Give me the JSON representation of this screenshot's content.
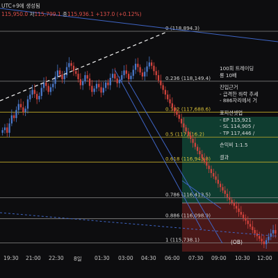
{
  "header": {
    "title_fragment": "UTC+9에 생성됨",
    "ohlc": {
      "open_value": "115,950.0",
      "high_prefix": "저",
      "high_value": "115,799.1",
      "close_prefix": "종",
      "close_value": "115,936.1",
      "change": "+137.0 (+0.12%)"
    }
  },
  "fib_levels": [
    {
      "ratio": "0",
      "price": "118,894.3",
      "text": "0 (118,894.3)",
      "color": "#8a8a8a"
    },
    {
      "ratio": "0.236",
      "price": "118,149.4",
      "text": "0.236 (118,149.4)",
      "color": "#8a8a8a"
    },
    {
      "ratio": "0.382",
      "price": "117,688.6",
      "text": "0.382 (117,688.6)",
      "color": "#c8b02a"
    },
    {
      "ratio": "0.5",
      "price": "117,316.2",
      "text": "0.5 (117,316.2)",
      "color": "#c8b02a"
    },
    {
      "ratio": "0.618",
      "price": "116,943.8",
      "text": "0.618 (116,943.8)",
      "color": "#c8b02a"
    },
    {
      "ratio": "0.786",
      "price": "116,413.5",
      "text": "0.786 (116,413.5)",
      "color": "#8a8a8a"
    },
    {
      "ratio": "0.886",
      "price": "116,098.9",
      "text": "0.886 (116,098.9)",
      "color": "#8a8a8a"
    },
    {
      "ratio": "1",
      "price": "115,738.1",
      "text": "1 (115,738.1)",
      "color": "#8a8a8a"
    }
  ],
  "side_note": {
    "lines": [
      "100회 트레이딩",
      "롱 10배",
      "",
      "진입근거",
      "- 급격한 하락 추세",
      "- 886자리에서 거",
      "",
      "포지션셋업",
      "- EP 115,921",
      "- SL 114,905 /",
      "- TP 117,446 /",
      "",
      "손익비 1:1.5",
      "",
      "결과"
    ]
  },
  "ob_label": "(OB)",
  "time_axis": {
    "labels": [
      "19:30",
      "21:00",
      "22:30",
      "8일",
      "01:30",
      "03:00",
      "04:30",
      "06:00",
      "07:30",
      "09:00",
      "10:30",
      "12:00"
    ]
  },
  "colors": {
    "background": "#0d0d0f",
    "candle_up": "#4a78c9",
    "candle_down": "#d0423c",
    "trend_line": "#3f66c7",
    "dashed_line": "#e8e8e8",
    "profit_zone": "#0f3d30",
    "loss_zone": "#4a1818",
    "fib_grey": "#8a8a8a",
    "fib_gold": "#c8b02a"
  },
  "chart_data": {
    "type": "candlestick",
    "ylim": [
      115650,
      119050
    ],
    "close_prices": [
      117420,
      117460,
      117380,
      117520,
      117640,
      117600,
      117720,
      117810,
      117760,
      117690,
      117740,
      117880,
      117950,
      118020,
      117960,
      117880,
      117930,
      118050,
      118130,
      118080,
      117990,
      118060,
      118110,
      118220,
      118310,
      118250,
      118180,
      118240,
      118360,
      118420,
      118380,
      118300,
      118260,
      118180,
      118090,
      118150,
      118240,
      118190,
      118080,
      117990,
      118040,
      118110,
      118060,
      117980,
      118050,
      118130,
      118090,
      118200,
      118260,
      118190,
      118120,
      118170,
      118240,
      118310,
      118260,
      118180,
      118230,
      118320,
      118410,
      118360,
      118280,
      118220,
      118290,
      118370,
      118430,
      118380,
      118300,
      118240,
      118160,
      118090,
      118020,
      117950,
      117880,
      117820,
      117760,
      117700,
      117650,
      117590,
      117520,
      117460,
      117400,
      117340,
      117290,
      117230,
      117170,
      117110,
      117060,
      117000,
      116950,
      116890,
      116840,
      116780,
      116730,
      116680,
      116620,
      116570,
      116520,
      116470,
      116420,
      116380,
      116340,
      116290,
      116250,
      116200,
      116160,
      116110,
      116070,
      116020,
      115980,
      115930,
      115880,
      115840,
      115800,
      115760,
      115720,
      115780,
      115830,
      115880,
      115930,
      115880
    ]
  }
}
